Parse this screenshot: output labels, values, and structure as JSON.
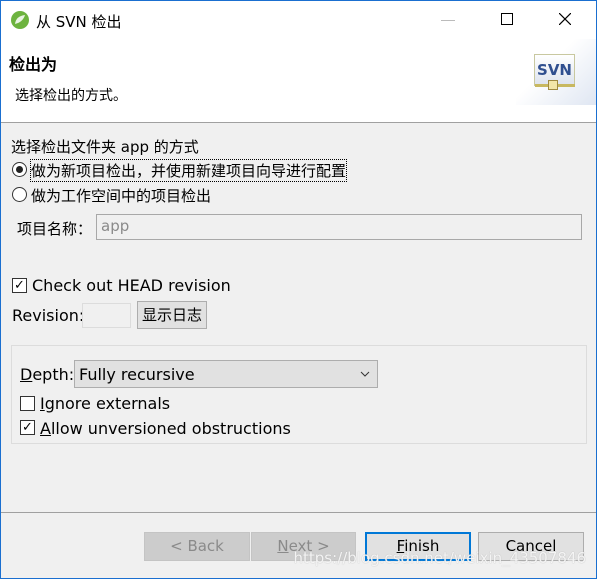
{
  "window": {
    "title": "从 SVN 检出",
    "icon": "spring-leaf-icon",
    "controls": [
      "minimize",
      "maximize",
      "close"
    ]
  },
  "header": {
    "title": "检出为",
    "description": "选择检出的方式。",
    "logo": "SVN"
  },
  "main": {
    "prompt": "选择检出文件夹 app 的方式",
    "radios": [
      {
        "label": "做为新项目检出，并使用新建项目向导进行配置",
        "checked": true
      },
      {
        "label": "做为工作空间中的项目检出",
        "checked": false
      }
    ],
    "project_name_label": "项目名称：",
    "project_name_value": "app",
    "head_revision": {
      "label": "Check out HEAD revision",
      "checked": true
    },
    "revision_label": "Revision:",
    "revision_value": "",
    "show_log": "显示日志",
    "depth_label": "Depth:",
    "depth_value": "Fully recursive",
    "ignore_externals": {
      "label": "Ignore externals",
      "checked": false
    },
    "allow_unversioned": {
      "label": "Allow unversioned obstructions",
      "checked": true
    }
  },
  "footer": {
    "back": "< Back",
    "next": "Next >",
    "finish": "Finish",
    "cancel": "Cancel"
  },
  "watermark": "https://blog.csdn.net/weixin_43507846",
  "colors": {
    "accent": "#0078d7",
    "border": "#1a6fd0"
  }
}
